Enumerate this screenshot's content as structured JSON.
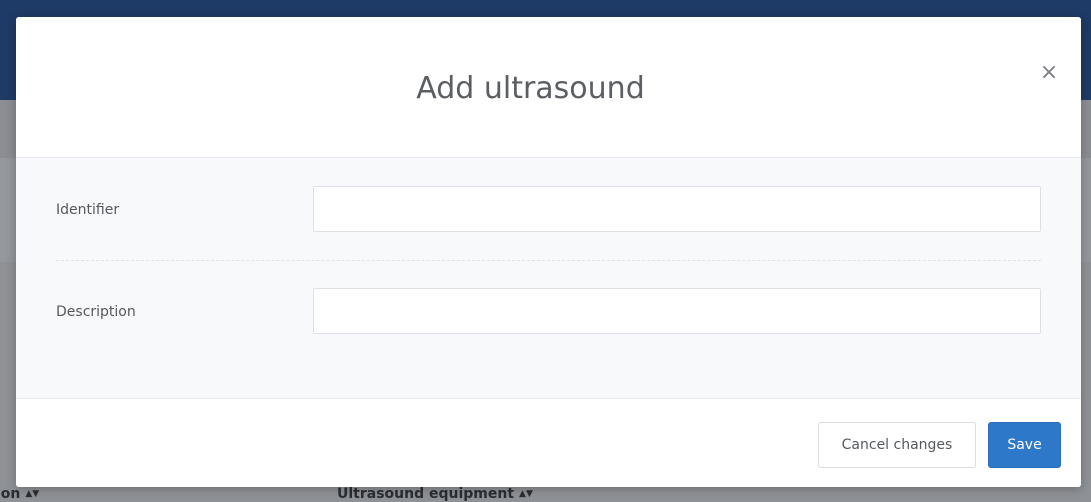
{
  "background": {
    "columns": [
      {
        "label": "ion",
        "sort_icon": "▲▼"
      },
      {
        "label": "Ultrasound equipment",
        "sort_icon": "▲▼"
      }
    ]
  },
  "modal": {
    "title": "Add ultrasound",
    "close_icon": "×",
    "fields": [
      {
        "label": "Identifier",
        "value": "",
        "placeholder": ""
      },
      {
        "label": "Description",
        "value": "",
        "placeholder": ""
      }
    ],
    "buttons": {
      "cancel_label": "Cancel changes",
      "save_label": "Save"
    }
  },
  "colors": {
    "header_bg": "#1e3a66",
    "overlay_bg": "#8f9297",
    "primary": "#2d78c9"
  }
}
